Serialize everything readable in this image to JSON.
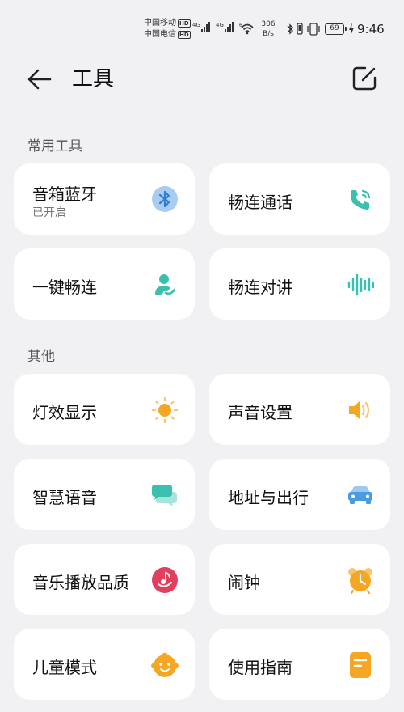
{
  "status_bar": {
    "carrier1": "中国移动",
    "carrier2": "中国电信",
    "hd": "HD",
    "net": "4G",
    "wifi_gen": "6",
    "speed_value": "306",
    "speed_unit": "B/s",
    "battery": "69",
    "time": "9:46"
  },
  "header": {
    "title": "工具"
  },
  "sections": {
    "common": "常用工具",
    "other": "其他"
  },
  "cards": {
    "speaker_bluetooth": {
      "label": "音箱蓝牙",
      "status": "已开启"
    },
    "smooth_call": {
      "label": "畅连通话"
    },
    "one_key_connect": {
      "label": "一键畅连"
    },
    "smooth_intercom": {
      "label": "畅连对讲"
    },
    "light_display": {
      "label": "灯效显示"
    },
    "sound_settings": {
      "label": "声音设置"
    },
    "smart_voice": {
      "label": "智慧语音"
    },
    "address_travel": {
      "label": "地址与出行"
    },
    "music_quality": {
      "label": "音乐播放品质"
    },
    "alarm": {
      "label": "闹钟"
    },
    "kids_mode": {
      "label": "儿童模式"
    },
    "user_guide": {
      "label": "使用指南"
    }
  },
  "colors": {
    "background": "#f1f1f3",
    "card": "#ffffff",
    "bluetooth": "#4a9be0",
    "teal": "#3bbfae",
    "orange": "#f5a623",
    "red": "#e0405e"
  }
}
